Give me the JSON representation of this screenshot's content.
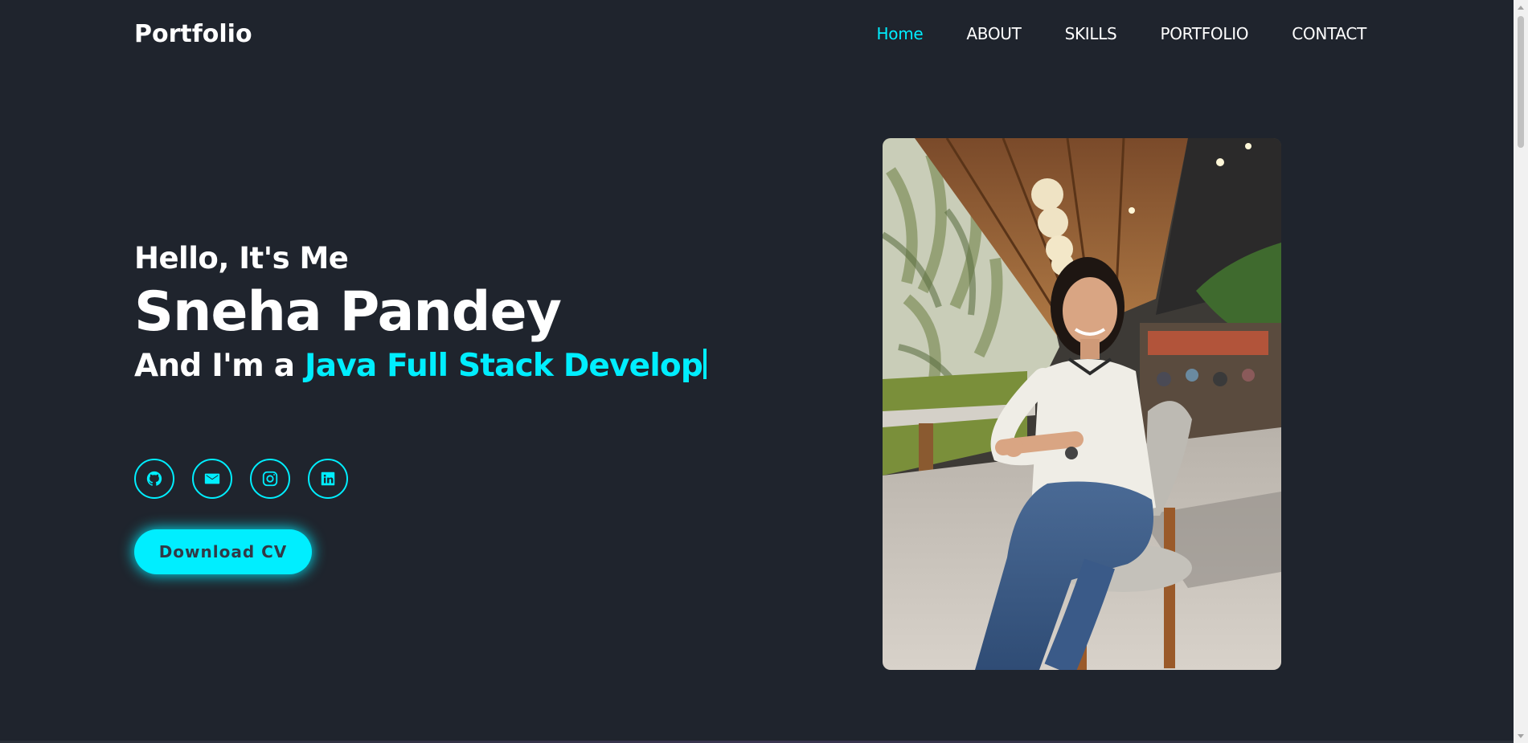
{
  "header": {
    "logo": "Portfolio",
    "nav": [
      {
        "label": "Home",
        "active": true
      },
      {
        "label": "ABOUT",
        "active": false
      },
      {
        "label": "SKILLS",
        "active": false
      },
      {
        "label": "PORTFOLIO",
        "active": false
      },
      {
        "label": "CONTACT",
        "active": false
      }
    ]
  },
  "hero": {
    "greeting": "Hello, It's Me",
    "name": "Sneha Pandey",
    "role_prefix": "And I'm a ",
    "role_typed": "Java Full Stack Develop",
    "socials": [
      {
        "icon": "github-icon"
      },
      {
        "icon": "mail-icon"
      },
      {
        "icon": "instagram-icon"
      },
      {
        "icon": "linkedin-icon"
      }
    ],
    "cta_label": "Download CV"
  },
  "colors": {
    "background": "#1f242d",
    "accent": "#00eeff",
    "text": "#ffffff",
    "button_text": "#323946"
  }
}
